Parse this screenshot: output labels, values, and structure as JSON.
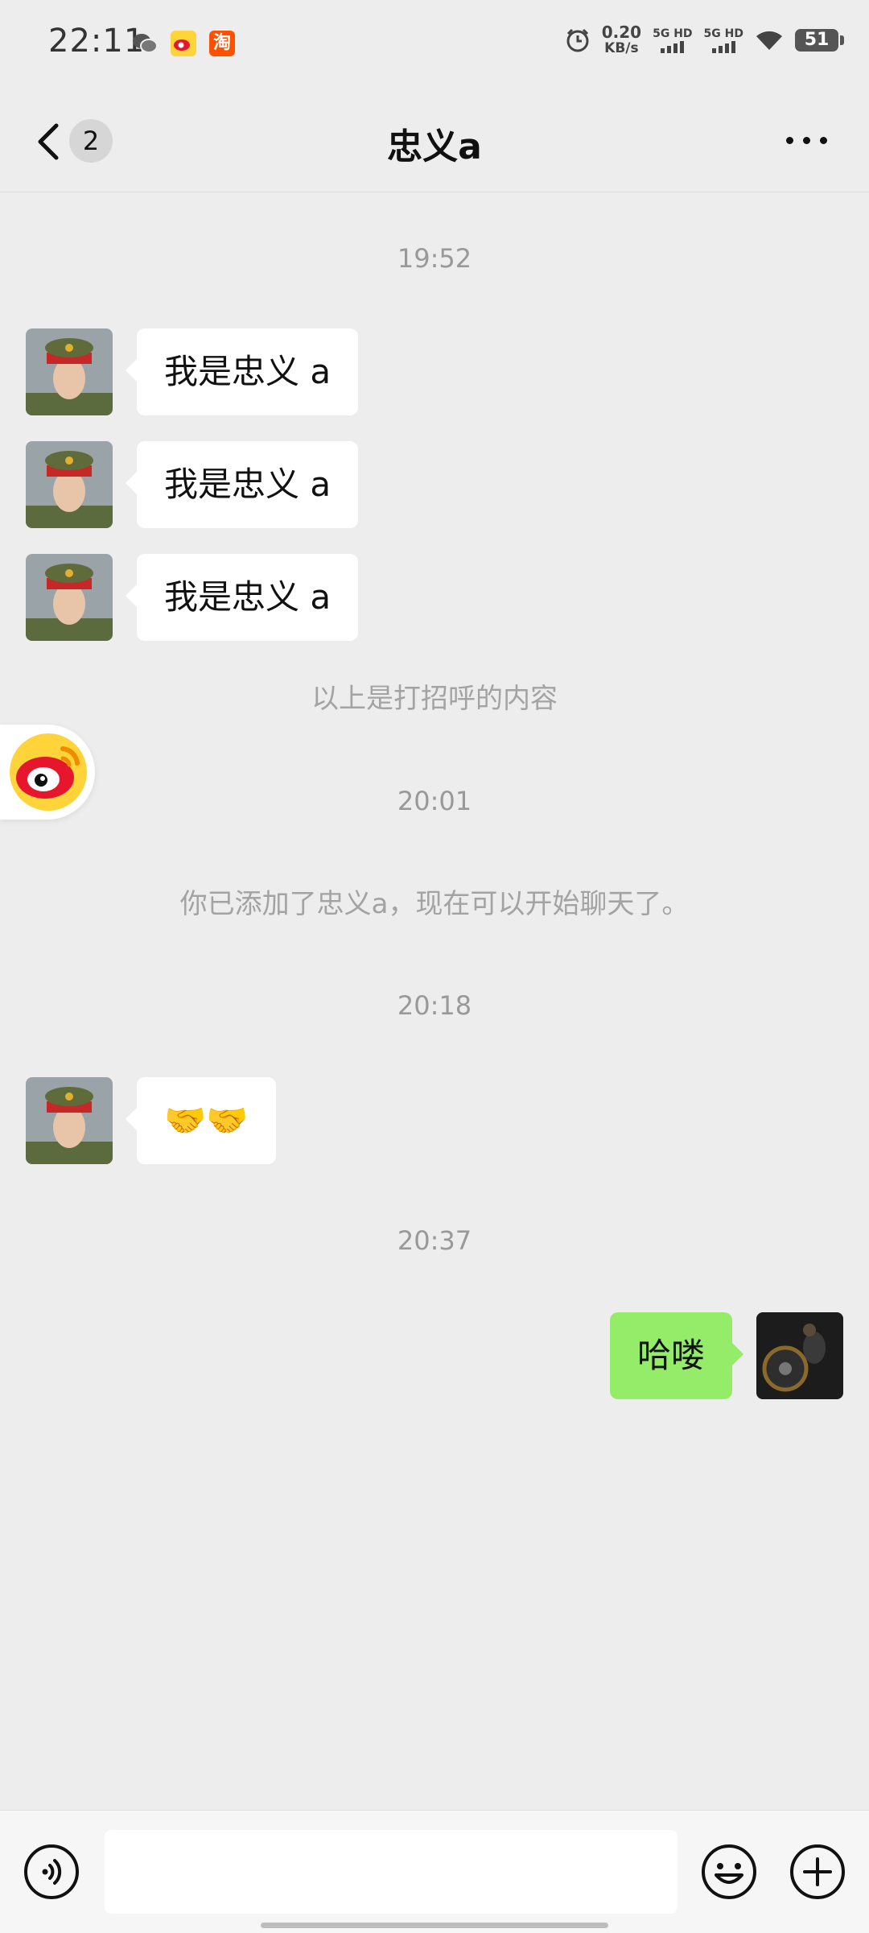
{
  "status_bar": {
    "time": "22:11",
    "net_speed_value": "0.20",
    "net_speed_unit": "KB/s",
    "sim1": "5G HD",
    "sim2": "5G HD",
    "battery": "51",
    "apps": [
      "wechat-icon",
      "weibo-icon",
      "taobao-icon"
    ],
    "taobao_char": "淘"
  },
  "header": {
    "unread_count": "2",
    "title": "忠义a"
  },
  "messages": {
    "ts1": "19:52",
    "greet1": "我是忠义 a",
    "greet2": "我是忠义 a",
    "greet3": "我是忠义 a",
    "greet_note": "以上是打招呼的内容",
    "ts2": "20:01",
    "added_note": "你已添加了忠义a，现在可以开始聊天了。",
    "ts3": "20:18",
    "handshake": "🤝🤝",
    "ts4": "20:37",
    "my_msg": "哈喽"
  },
  "colors": {
    "background": "#ededed",
    "my_bubble": "#95ec69",
    "their_bubble": "#ffffff"
  }
}
